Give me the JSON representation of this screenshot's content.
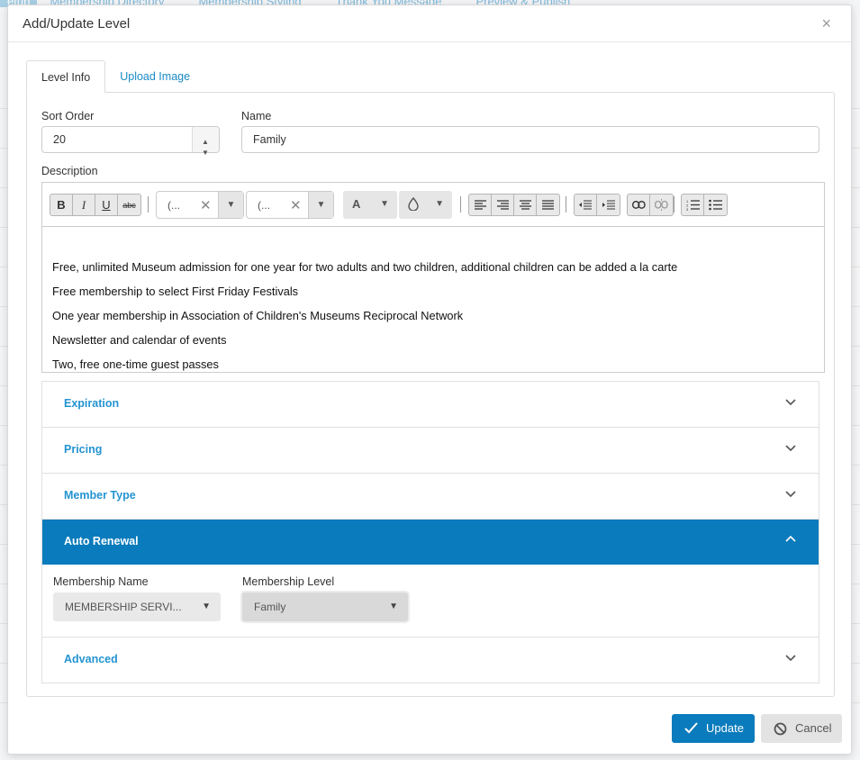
{
  "background": {
    "tabs": [
      "etup",
      "Membership Directory",
      "Membership Styling",
      "Thank You Message",
      "Preview & Publish"
    ]
  },
  "modal": {
    "title": "Add/Update Level",
    "close_glyph": "×",
    "tabs": [
      {
        "label": "Level Info",
        "active": true
      },
      {
        "label": "Upload Image",
        "active": false
      }
    ],
    "sort_order": {
      "label": "Sort Order",
      "value": "20"
    },
    "name": {
      "label": "Name",
      "value": "Family"
    },
    "description": {
      "label": "Description",
      "font_family_value": "(...",
      "font_size_value": "(...",
      "text_color_glyph": "A",
      "paragraphs": [
        "Free, unlimited Museum admission for one year for two adults and two children, additional children can be added a la carte",
        "Free membership to select First Friday Festivals",
        "One year membership in Association of Children's Museums Reciprocal Network",
        "Newsletter and calendar of events",
        "Two, free one-time guest passes"
      ]
    },
    "sections": [
      {
        "label": "Expiration",
        "open": false
      },
      {
        "label": "Pricing",
        "open": false
      },
      {
        "label": "Member Type",
        "open": false
      },
      {
        "label": "Auto Renewal",
        "open": true
      },
      {
        "label": "Advanced",
        "open": false
      }
    ],
    "auto_renewal": {
      "membership_name_label": "Membership Name",
      "membership_name_value": "MEMBERSHIP SERVI...",
      "membership_level_label": "Membership Level",
      "membership_level_value": "Family"
    },
    "buttons": {
      "update": "Update",
      "cancel": "Cancel"
    }
  },
  "colors": {
    "accent": "#0a7bbc",
    "link": "#2494d1"
  }
}
